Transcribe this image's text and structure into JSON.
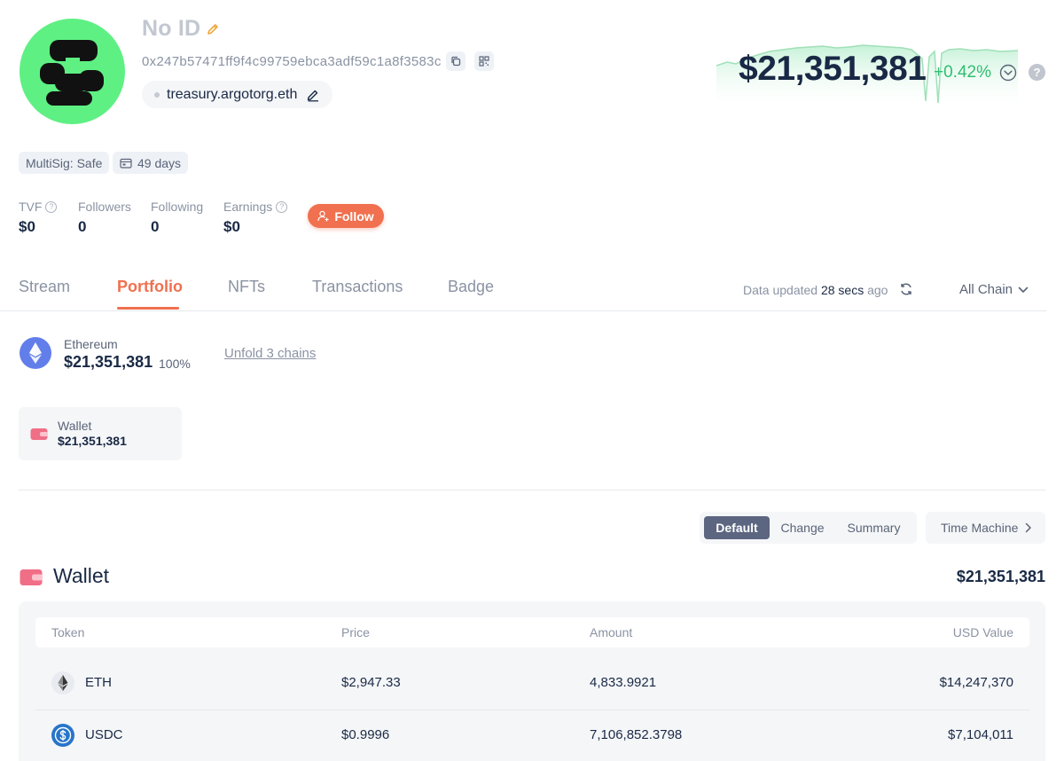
{
  "profile": {
    "name": "No ID",
    "address": "0x247b57471ff9f4c99759ebca3adf59c1a8f3583c",
    "ens": "treasury.argotorg.eth",
    "net_worth": "$21,351,381",
    "net_change": "+0.42%",
    "help_glyph": "?",
    "tags": {
      "multisig": "MultiSig: Safe",
      "age": "49 days"
    },
    "stats": [
      {
        "label": "TVF",
        "value": "$0"
      },
      {
        "label": "Followers",
        "value": "0"
      },
      {
        "label": "Following",
        "value": "0"
      },
      {
        "label": "Earnings",
        "value": "$0"
      }
    ],
    "follow_label": "Follow"
  },
  "tabs": [
    "Stream",
    "Portfolio",
    "NFTs",
    "Transactions",
    "Badge"
  ],
  "active_tab": "Portfolio",
  "data_updated": {
    "prefix": "Data updated",
    "time": "28 secs",
    "suffix": "ago"
  },
  "chain_filter": "All Chain",
  "chain_summary": {
    "name": "Ethereum",
    "value": "$21,351,381",
    "percent": "100%",
    "unfold_label": "Unfold 3 chains"
  },
  "wallet_card": {
    "label": "Wallet",
    "value": "$21,351,381"
  },
  "view_modes": [
    "Default",
    "Change",
    "Summary"
  ],
  "active_view": "Default",
  "time_machine_label": "Time Machine",
  "wallet_section": {
    "title": "Wallet",
    "total": "$21,351,381",
    "columns": [
      "Token",
      "Price",
      "Amount",
      "USD Value"
    ],
    "rows": [
      {
        "token": "ETH",
        "price": "$2,947.33",
        "amount": "4,833.9921",
        "usd_value": "$14,247,370"
      },
      {
        "token": "USDC",
        "price": "$0.9996",
        "amount": "7,106,852.3798",
        "usd_value": "$7,104,011"
      }
    ]
  },
  "colors": {
    "accent": "#f0704f",
    "positive": "#2fbf71",
    "avatar_bg": "#5ef083",
    "ethereum": "#627eea",
    "usdc": "#2775ca"
  },
  "icons": {
    "edit": "pencil-icon",
    "copy": "copy-icon",
    "qr": "qr-code-icon",
    "help": "question-circle-icon",
    "dropdown": "chevron-down-circle-icon",
    "refresh": "refresh-icon",
    "wallet": "wallet-icon",
    "calendar": "calendar-icon",
    "follow": "user-plus-icon"
  }
}
